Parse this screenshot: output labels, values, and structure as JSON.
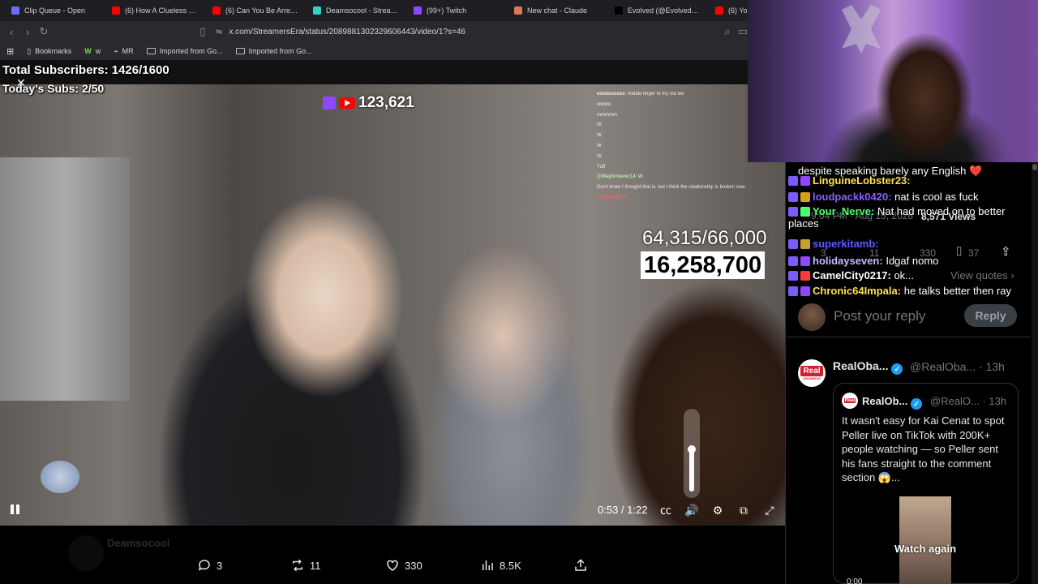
{
  "browser": {
    "tabs": [
      {
        "title": "Clip Queue - Open",
        "icon": "clip-queue",
        "color": "#6b6bff"
      },
      {
        "title": "(6) How A Clueless Killer...",
        "icon": "youtube",
        "color": "#ff0000"
      },
      {
        "title": "(6) Can You Be Arrested...",
        "icon": "youtube",
        "color": "#ff0000"
      },
      {
        "title": "Deamsocool - Stream...",
        "icon": "tt",
        "color": "#2fd3c6"
      },
      {
        "title": "(99+) Twitch",
        "icon": "twitch",
        "color": "#9146ff"
      },
      {
        "title": "New chat - Claude",
        "icon": "claude",
        "color": "#d97757"
      },
      {
        "title": "Evolved (@EvolvedTalent)",
        "icon": "x",
        "color": "#000000"
      },
      {
        "title": "(6) YouTube",
        "icon": "youtube",
        "color": "#ff0000"
      }
    ],
    "url": "x.com/StreamersEra/status/2089881302329606443/video/1?s=46",
    "bookmarks": [
      {
        "label": "Bookmarks",
        "icon": "bookmarks-icon"
      },
      {
        "label": "w",
        "icon": "w"
      },
      {
        "label": "MR",
        "icon": "mr"
      },
      {
        "label": "Imported from Go...",
        "icon": "folder-icon"
      },
      {
        "label": "Imported from Go...",
        "icon": "folder-icon"
      }
    ]
  },
  "stream_overlay": {
    "total_subs": "Total Subscribers: 1426/1600",
    "today_subs": "Today's Subs: 2/50",
    "viewers": "123,621",
    "sub_goal": "64,315/66,000",
    "money": "16,258,700",
    "faded_text": "Post"
  },
  "stream_chat": [
    {
      "user": "exoticsocks",
      "msg": "middle finger to my old life",
      "color": "#ffffff"
    },
    {
      "user": "",
      "msg": "wwww",
      "color": "#ffffff"
    },
    {
      "user": "",
      "msg": "mmmmm",
      "color": "#ffffff"
    },
    {
      "user": "",
      "msg": "W",
      "color": "#ffffff"
    },
    {
      "user": "",
      "msg": "W",
      "color": "#ffffff"
    },
    {
      "user": "",
      "msg": "W",
      "color": "#ffffff"
    },
    {
      "user": "",
      "msg": "W",
      "color": "#ffffff"
    },
    {
      "user": "",
      "msg": "Tuff",
      "color": "#ffffff"
    },
    {
      "user": "@Maylichavez14",
      "msg": "W",
      "color": "#b6ffb0"
    },
    {
      "user": "",
      "msg": "Don't know I thought that is. but I think the relationship is broken now",
      "color": "#ffffff"
    },
    {
      "user": "KIDVARBITY",
      "msg": "",
      "color": "#ff6060"
    }
  ],
  "player": {
    "time": "0:53 / 1:22",
    "volume": 0.55,
    "icons": [
      "captions-icon",
      "volume-icon",
      "settings-icon",
      "pip-icon",
      "fullscreen-icon"
    ]
  },
  "below_video": {
    "ghost_name": "Deamsocool",
    "actions": [
      {
        "name": "reply",
        "count": "3"
      },
      {
        "name": "retweet",
        "count": "11"
      },
      {
        "name": "like",
        "count": "330"
      },
      {
        "name": "views",
        "count": "8.5K"
      },
      {
        "name": "share",
        "count": ""
      }
    ]
  },
  "live_chat": [
    {
      "user": "",
      "msg": "despite speaking barely any English",
      "user_color": "#ffffff",
      "emoji": "❤️"
    },
    {
      "user": "LinguineLobster23:",
      "msg": "",
      "user_color": "#ffe14d"
    },
    {
      "user": "loudpackk0420:",
      "msg": "nat is cool as fuck",
      "user_color": "#8a5cff"
    },
    {
      "user": "Your_Nerve:",
      "msg": "Nat had moved on to better places",
      "user_color": "#4cff6a"
    },
    {
      "user": "superkitamb:",
      "msg": "",
      "user_color": "#5a5cff"
    },
    {
      "user": "holidayseven:",
      "msg": "Idgaf nomo",
      "user_color": "#c9b8ff"
    },
    {
      "user": "CamelCity0217:",
      "msg": "ok...",
      "user_color": "#ffffff"
    },
    {
      "user": "Chronic64Impala:",
      "msg": "he talks better then ray",
      "user_color": "#ffe14d"
    }
  ],
  "x_underlay": {
    "timestamp": "9:04 PM · Aug 15, 2026",
    "views": "8,571 Views",
    "reply_count": "3",
    "retweet_count": "11",
    "like_count": "330",
    "bookmark_count": "37",
    "view_quotes": "View quotes"
  },
  "reply": {
    "placeholder": "Post your reply",
    "button": "Reply"
  },
  "tweet": {
    "name": "RealOba...",
    "handle": "@RealOba... · 13h",
    "avatar_text": "Real",
    "avatar_sub": "OBAMEDIA",
    "quote": {
      "name": "RealOb...",
      "handle": "@RealO... · 13h",
      "text": "It wasn't easy for Kai Cenat to spot Peller live on TikTok with 200K+ people watching — so Peller sent his fans straight to the comment section 😱...",
      "watch_again": "Watch again",
      "timer": "0:00"
    }
  },
  "colors": {
    "accent": "#1d9bf0",
    "background": "#000000",
    "muted": "#71767b"
  }
}
